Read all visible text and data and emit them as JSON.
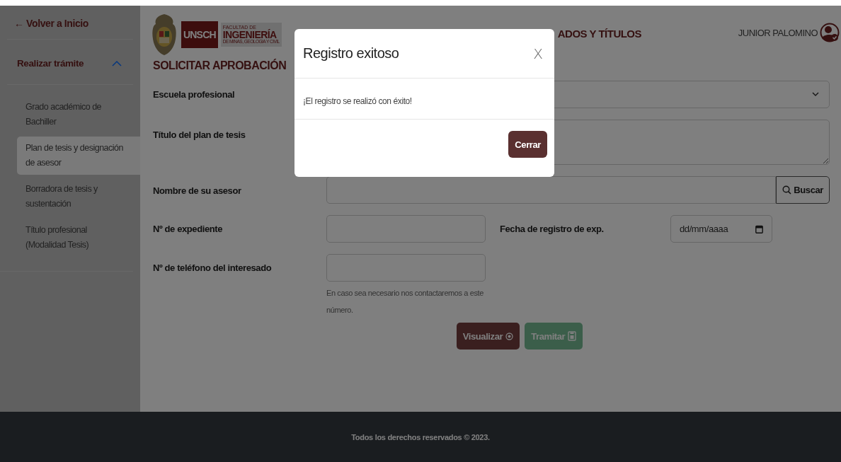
{
  "sidebar": {
    "back_link": "← Volver a Inicio",
    "section": {
      "label": "Realizar trámite",
      "expanded": true
    },
    "items": [
      {
        "label": "Grado académico de Bachiller",
        "selected": false
      },
      {
        "label": "Plan de tesis y designación de asesor",
        "selected": true
      },
      {
        "label": "Borradora de tesis y sustentación",
        "selected": false
      },
      {
        "label": "Título profesional (Modalidad Tesis)",
        "selected": false
      }
    ]
  },
  "header": {
    "logo": {
      "short": "UNSCH",
      "line_1": "FACULTAD DE",
      "line_2": "INGENIERÍA",
      "line_3": "DE MINAS, GEOLOGIA Y CIVIL"
    },
    "title": "ADOS Y TÍTULOS",
    "user": "JUNIOR PALOMINO"
  },
  "form": {
    "heading": "SOLICITAR APROBACIÓN",
    "rows": [
      {
        "label": "Escuela profesional",
        "kind": "select"
      },
      {
        "label": "Título del plan de tesis",
        "kind": "textarea"
      },
      {
        "label": "Nombre de su asesor",
        "kind": "search",
        "button": "Buscar"
      },
      {
        "label": "Nº de expediente",
        "kind": "pair",
        "second_label": "Fecha de registro de exp.",
        "date_placeholder": "dd/mm/aaaa"
      },
      {
        "label": "Nº de teléfono del interesado",
        "kind": "input",
        "help": "En caso sea necesario nos contactaremos a este número."
      }
    ],
    "buttons": [
      {
        "label": "Visualizar",
        "kind": "view",
        "disabled": false
      },
      {
        "label": "Tramitar",
        "kind": "save",
        "disabled": true
      }
    ]
  },
  "footer": "Todos los derechos reservados © 2023.",
  "modal": {
    "title": "Registro exitoso",
    "close": "X",
    "message": "¡El registro se realizó con éxito!",
    "button": "Cerrar"
  }
}
